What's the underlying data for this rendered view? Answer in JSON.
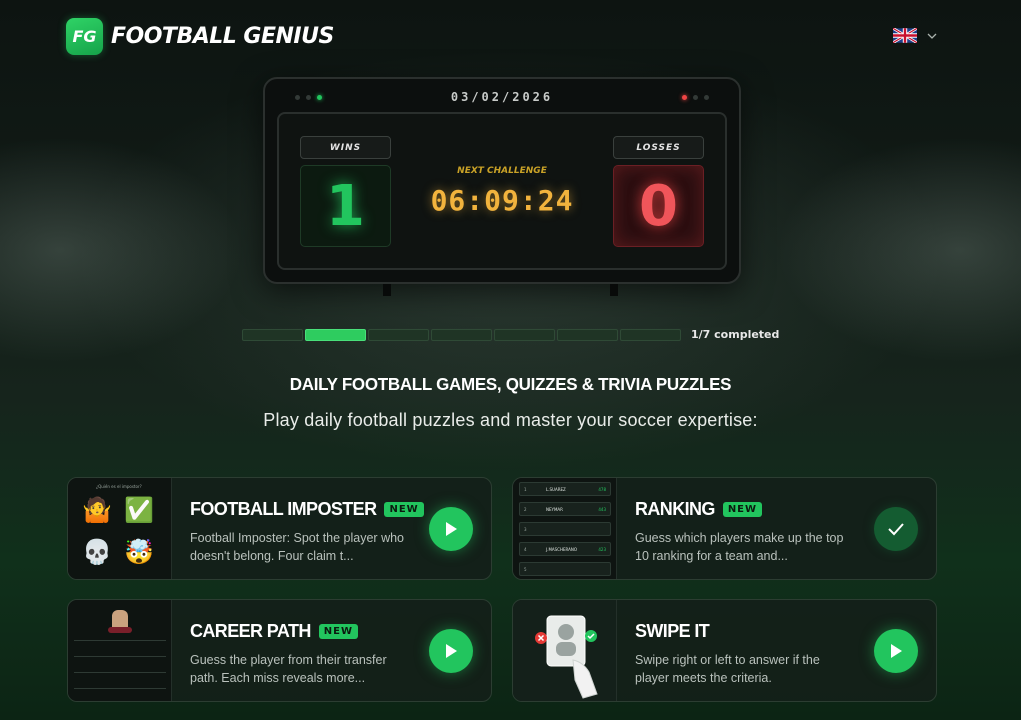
{
  "header": {
    "logo_badge": "FG",
    "logo_text": "FOOTBALL GENIUS",
    "language_flag": "uk-flag-icon"
  },
  "scoreboard": {
    "date": "03/02/2026",
    "wins_label": "WINS",
    "wins_value": "1",
    "losses_label": "LOSSES",
    "losses_value": "0",
    "next_label": "NEXT CHALLENGE",
    "countdown": "06:09:24"
  },
  "progress": {
    "completed": 1,
    "total": 7,
    "label": "1/7 completed"
  },
  "intro": {
    "headline": "DAILY FOOTBALL GAMES, QUIZZES & TRIVIA PUZZLES",
    "subtitle": "Play daily football puzzles and master your soccer expertise:"
  },
  "games": [
    {
      "title": "FOOTBALL IMPOSTER",
      "badge": "NEW",
      "description": "Football Imposter: Spot the player who doesn't belong. Four claim t...",
      "action": "play",
      "thumb_emojis": [
        "🤷",
        "✅",
        "💀",
        "🤯"
      ]
    },
    {
      "title": "RANKING",
      "badge": "NEW",
      "description": "Guess which players make up the top 10 ranking for a team and...",
      "action": "completed",
      "thumb_rows": [
        {
          "rank": "1",
          "name": "L.SUAREZ",
          "value": "478"
        },
        {
          "rank": "2",
          "name": "NEYMAR",
          "value": "443"
        },
        {
          "rank": "3",
          "name": "",
          "value": ""
        },
        {
          "rank": "4",
          "name": "J.MASCHERANO",
          "value": "423"
        },
        {
          "rank": "5",
          "name": "",
          "value": ""
        }
      ]
    },
    {
      "title": "CAREER PATH",
      "badge": "NEW",
      "description": "Guess the player from their transfer path. Each miss reveals more...",
      "action": "play"
    },
    {
      "title": "SWIPE IT",
      "badge": "",
      "description": "Swipe right or left to answer if the player meets the criteria.",
      "action": "play"
    }
  ],
  "colors": {
    "accent": "#22c55e",
    "loss": "#ef4444",
    "timer": "#f2b33d"
  }
}
